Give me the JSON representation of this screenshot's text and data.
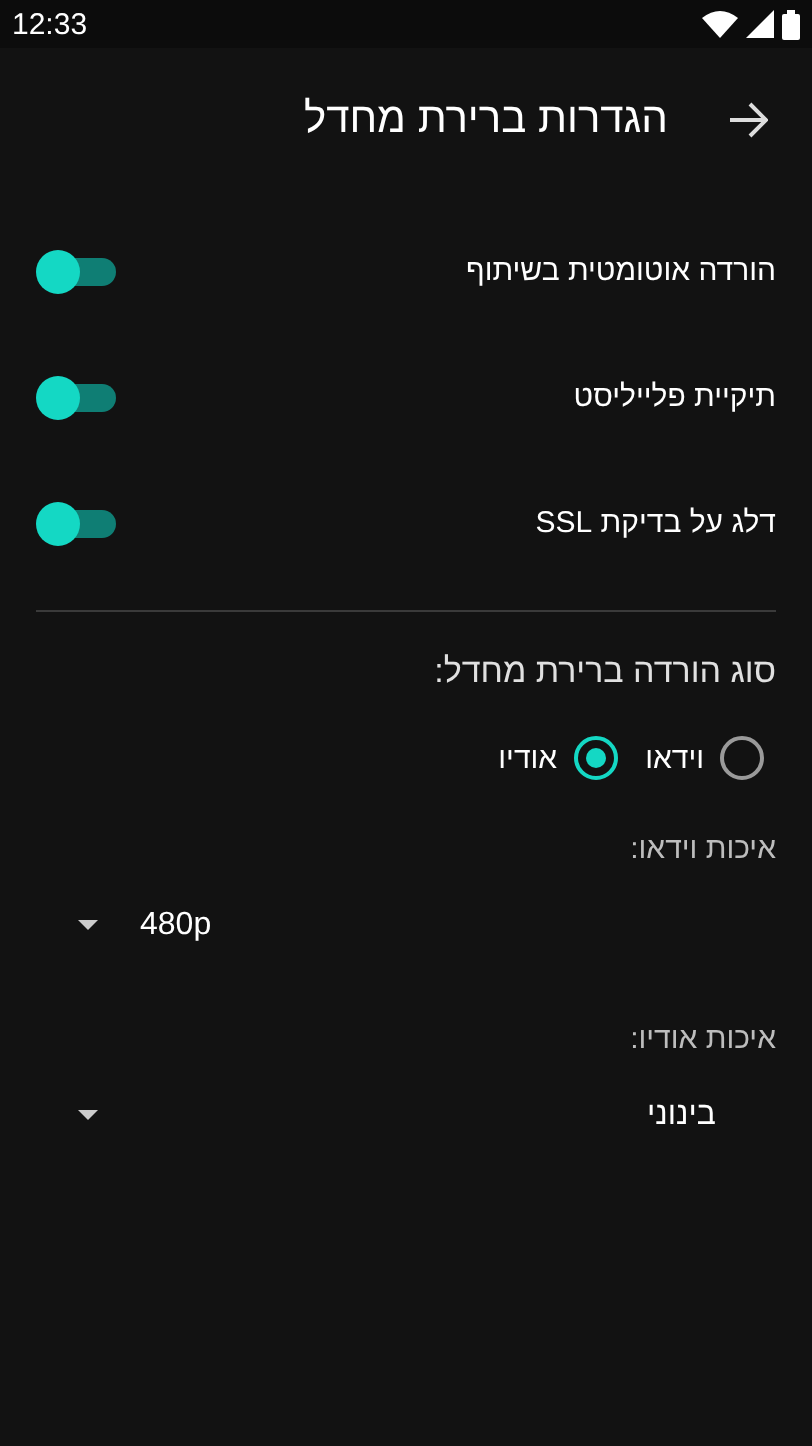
{
  "status_bar": {
    "time": "12:33"
  },
  "toolbar": {
    "title": "הגדרות ברירת מחדל"
  },
  "switches": [
    {
      "label": "הורדה אוטומטית בשיתוף",
      "on": true
    },
    {
      "label": "תיקיית פלייליסט",
      "on": true
    },
    {
      "label": "דלג על בדיקת SSL",
      "on": true
    }
  ],
  "download_type": {
    "title": "סוג הורדה ברירת מחדל:",
    "options": [
      {
        "label": "וידאו",
        "selected": false
      },
      {
        "label": "אודיו",
        "selected": true
      }
    ]
  },
  "dropdowns": [
    {
      "label": "איכות וידאו:",
      "value": "480p"
    },
    {
      "label": "איכות אודיו:",
      "value": "בינוני"
    }
  ]
}
